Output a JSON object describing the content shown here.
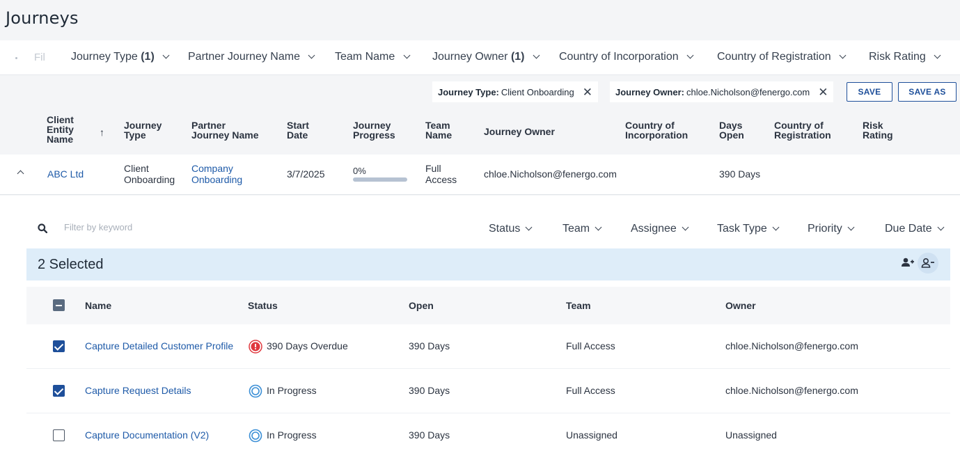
{
  "page": {
    "title": "Journeys"
  },
  "filters": {
    "search_placeholder": "Fil",
    "items": [
      {
        "label": "Journey Type",
        "count": "(1)"
      },
      {
        "label": "Partner Journey Name",
        "count": ""
      },
      {
        "label": "Team Name",
        "count": ""
      },
      {
        "label": "Journey Owner",
        "count": "(1)"
      },
      {
        "label": "Country of Incorporation",
        "count": ""
      },
      {
        "label": "Country of Registration",
        "count": ""
      },
      {
        "label": "Risk Rating",
        "count": ""
      }
    ]
  },
  "applied_filters": [
    {
      "key": "Journey Type:",
      "value": "Client Onboarding"
    },
    {
      "key": "Journey Owner:",
      "value": "chloe.Nicholson@fenergo.com"
    }
  ],
  "actions": {
    "save": "SAVE",
    "save_as": "SAVE AS"
  },
  "journey_grid": {
    "headers": {
      "client": [
        "Client",
        "Entity",
        "Name"
      ],
      "journey_type": [
        "Journey",
        "Type"
      ],
      "partner": [
        "Partner",
        "Journey Name"
      ],
      "start_date": [
        "Start",
        "Date"
      ],
      "progress": [
        "Journey",
        "Progress"
      ],
      "team": [
        "Team",
        "Name"
      ],
      "owner": "Journey Owner",
      "country_inc": [
        "Country of",
        "Incorporation"
      ],
      "days_open": [
        "Days",
        "Open"
      ],
      "country_reg": [
        "Country of",
        "Registration"
      ],
      "risk": [
        "Risk",
        "Rating"
      ]
    },
    "row": {
      "client": "ABC Ltd",
      "journey_type": [
        "Client",
        "Onboarding"
      ],
      "partner": [
        "Company",
        "Onboarding"
      ],
      "start_date": "3/7/2025",
      "progress_text": "0%",
      "progress_value": 0,
      "team": [
        "Full",
        "Access"
      ],
      "owner": "chloe.Nicholson@fenergo.com",
      "days_open": "390 Days"
    }
  },
  "tasks": {
    "search_placeholder": "Filter by keyword",
    "filters": [
      "Status",
      "Team",
      "Assignee",
      "Task Type",
      "Priority",
      "Due Date"
    ],
    "selected_text": "2 Selected",
    "headers": {
      "name": "Name",
      "status": "Status",
      "open": "Open",
      "team": "Team",
      "owner": "Owner"
    },
    "rows": [
      {
        "checked": true,
        "name": "Capture Detailed Customer Profile",
        "status": "390 Days Overdue",
        "status_kind": "overdue",
        "open": "390 Days",
        "team": "Full Access",
        "owner": "chloe.Nicholson@fenergo.com"
      },
      {
        "checked": true,
        "name": "Capture Request Details",
        "status": "In Progress",
        "status_kind": "in-progress",
        "open": "390 Days",
        "team": "Full Access",
        "owner": "chloe.Nicholson@fenergo.com"
      },
      {
        "checked": false,
        "name": "Capture Documentation (V2)",
        "status": "In Progress",
        "status_kind": "in-progress",
        "open": "390 Days",
        "team": "Unassigned",
        "owner": "Unassigned"
      }
    ]
  },
  "colors": {
    "accent": "#1e4f9a",
    "link": "#1e5aa8",
    "overdue": "#e0383e",
    "in_progress": "#3b8fd6",
    "selected_bar": "#deedf9"
  }
}
